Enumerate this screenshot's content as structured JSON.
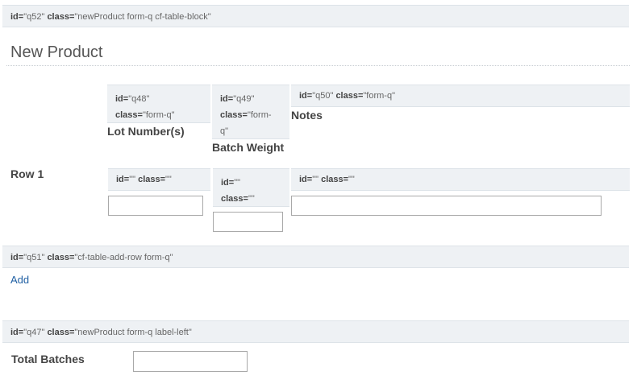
{
  "meta_q52": {
    "id_key": "id=",
    "id_val": "\"q52\"",
    "class_key": "class=",
    "class_val": "\"newProduct form-q cf-table-block\""
  },
  "section_title": "New Product",
  "col_q48": {
    "line1_key": "id=",
    "line1_val": "\"q48\"",
    "line2_key": "class=",
    "line2_val": "\"form-q\""
  },
  "col_q49": {
    "line1_key": "id=",
    "line1_val": "\"q49\"",
    "line2_key": "class=",
    "line2_val": "\"form-",
    "line3_val": "q\""
  },
  "col_q50": {
    "id_key": "id=",
    "id_val": "\"q50\"",
    "class_key": "class=",
    "class_val": "\"form-q\""
  },
  "headers": {
    "lot": "Lot Number(s)",
    "batch": "Batch Weight",
    "notes": "Notes"
  },
  "row": {
    "label": "Row 1"
  },
  "cell_meta": {
    "a": {
      "id_key": "id=",
      "id_val": "\"\"",
      "class_key": "class=",
      "class_val": "\"\""
    },
    "b": {
      "id_key": "id=",
      "id_val": "\"\"",
      "class_key": "class=",
      "class_val": "\"\""
    },
    "c": {
      "id_key": "id=",
      "id_val": "\"\"",
      "class_key": "class=",
      "class_val": "\"\""
    }
  },
  "inputs": {
    "lot_value": "",
    "batch_value": "",
    "notes_value": ""
  },
  "meta_q51": {
    "id_key": "id=",
    "id_val": "\"q51\"",
    "class_key": "class=",
    "class_val": "\"cf-table-add-row form-q\""
  },
  "add_label": "Add",
  "meta_q47": {
    "id_key": "id=",
    "id_val": "\"q47\"",
    "class_key": "class=",
    "class_val": "\"newProduct form-q label-left\""
  },
  "total_batches": {
    "label": "Total Batches",
    "value": ""
  }
}
